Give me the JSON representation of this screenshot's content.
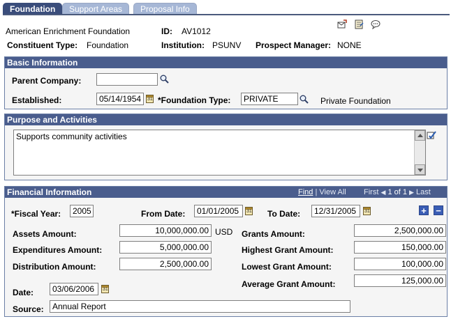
{
  "tabs": [
    "Foundation",
    "Support Areas",
    "Proposal Info"
  ],
  "header": {
    "org_name": "American Enrichment Foundation",
    "id_label": "ID:",
    "id_value": "AV1012",
    "constituent_type_label": "Constituent Type:",
    "constituent_type_value": "Foundation",
    "institution_label": "Institution:",
    "institution_value": "PSUNV",
    "prospect_manager_label": "Prospect Manager:",
    "prospect_manager_value": "NONE"
  },
  "basic": {
    "title": "Basic Information",
    "parent_company_label": "Parent Company:",
    "parent_company_value": "",
    "established_label": "Established:",
    "established_value": "05/14/1954",
    "foundation_type_label": "*Foundation Type:",
    "foundation_type_value": "PRIVATE",
    "foundation_type_desc": "Private Foundation"
  },
  "purpose": {
    "title": "Purpose and Activities",
    "text": "Supports community activities"
  },
  "financial": {
    "title": "Financial Information",
    "nav": {
      "find": "Find",
      "sep": "|",
      "view_all": "View All",
      "first": "First",
      "counter": "1 of 1",
      "last": "Last"
    },
    "fiscal_year_label": "*Fiscal Year:",
    "fiscal_year_value": "2005",
    "from_date_label": "From Date:",
    "from_date_value": "01/01/2005",
    "to_date_label": "To Date:",
    "to_date_value": "12/31/2005",
    "assets_label": "Assets Amount:",
    "assets_value": "10,000,000.00",
    "currency": "USD",
    "expenditures_label": "Expenditures Amount:",
    "expenditures_value": "5,000,000.00",
    "distribution_label": "Distribution Amount:",
    "distribution_value": "2,500,000.00",
    "grants_label": "Grants Amount:",
    "grants_value": "2,500,000.00",
    "highest_grant_label": "Highest Grant Amount:",
    "highest_grant_value": "150,000.00",
    "lowest_grant_label": "Lowest Grant Amount:",
    "lowest_grant_value": "100,000.00",
    "average_grant_label": "Average Grant Amount:",
    "average_grant_value": "125,000.00",
    "date_label": "Date:",
    "date_value": "03/06/2006",
    "source_label": "Source:",
    "source_value": "Annual Report"
  },
  "icons": {
    "notify": "notify-icon",
    "notepad": "notepad-icon",
    "chat": "chat-icon",
    "lookup": "search-icon",
    "calendar": "calendar-icon",
    "spellcheck": "spellcheck-icon",
    "add": "+",
    "remove": "−",
    "first": "◀",
    "last": "▶"
  },
  "colors": {
    "group_header": "#4a5d8d",
    "tab_active": "#3a4d7b",
    "tab_inactive": "#a6b7d6",
    "group_bg": "#f5f5f5"
  }
}
